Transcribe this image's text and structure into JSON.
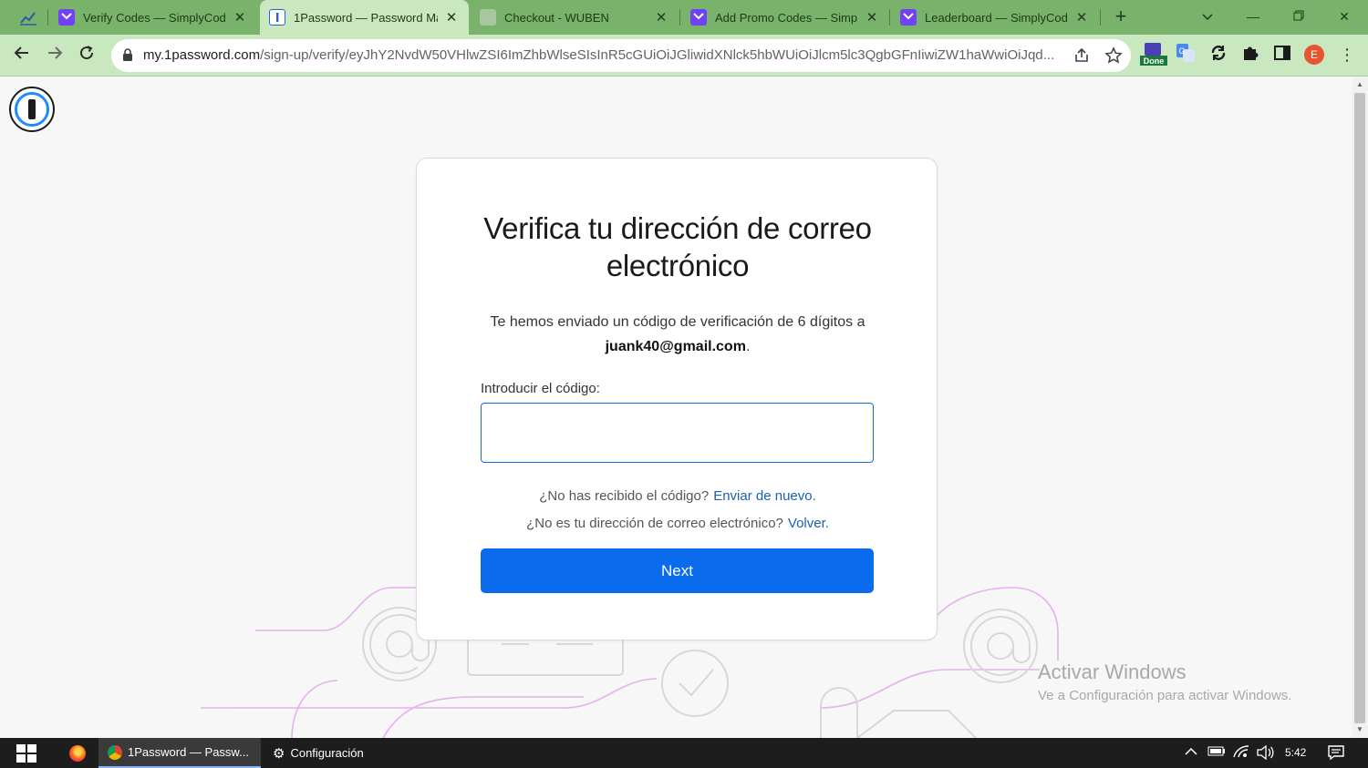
{
  "browser": {
    "tabs": [
      {
        "title": "",
        "favicon": "chart-icon"
      },
      {
        "title": "Verify Codes — SimplyCodes",
        "favicon": "simplycodes-icon"
      },
      {
        "title": "1Password — Password Manager",
        "favicon": "1password-icon",
        "active": true
      },
      {
        "title": "Checkout - WUBEN",
        "favicon": "wuben-icon"
      },
      {
        "title": "Add Promo Codes — SimplyCodes",
        "favicon": "simplycodes-icon"
      },
      {
        "title": "Leaderboard — SimplyCodes",
        "favicon": "simplycodes-icon"
      }
    ],
    "url_host": "my.1password.com",
    "url_path": "/sign-up/verify/eyJhY2NvdW50VHlwZSI6ImZhbWlseSIsInR5cGUiOiJGliwidXNlck5hbWUiOiJlcm5lc3QgbGFnIiwiZW1haWwiOiJqd...",
    "extension_badge": "Done",
    "profile_initial": "E"
  },
  "page": {
    "title": "Verifica tu dirección de correo electrónico",
    "description": "Te hemos enviado un código de verificación de 6 dígitos a",
    "email": "juank40@gmail.com",
    "code_label": "Introducir el código:",
    "code_value": "",
    "resend_question": "¿No has recibido el código?",
    "resend_link": "Enviar de nuevo.",
    "back_question": "¿No es tu dirección de correo electrónico?",
    "back_link": "Volver.",
    "next_button": "Next",
    "accent_color": "#0a6cec"
  },
  "watermark": {
    "line1": "Activar Windows",
    "line2": "Ve a Configuración para activar Windows."
  },
  "taskbar": {
    "apps": [
      {
        "label": "1Password — Passw...",
        "icon": "chrome-icon",
        "active": true
      },
      {
        "label": "Configuración",
        "icon": "gear-icon",
        "active": false
      }
    ],
    "clock": "5:42"
  }
}
